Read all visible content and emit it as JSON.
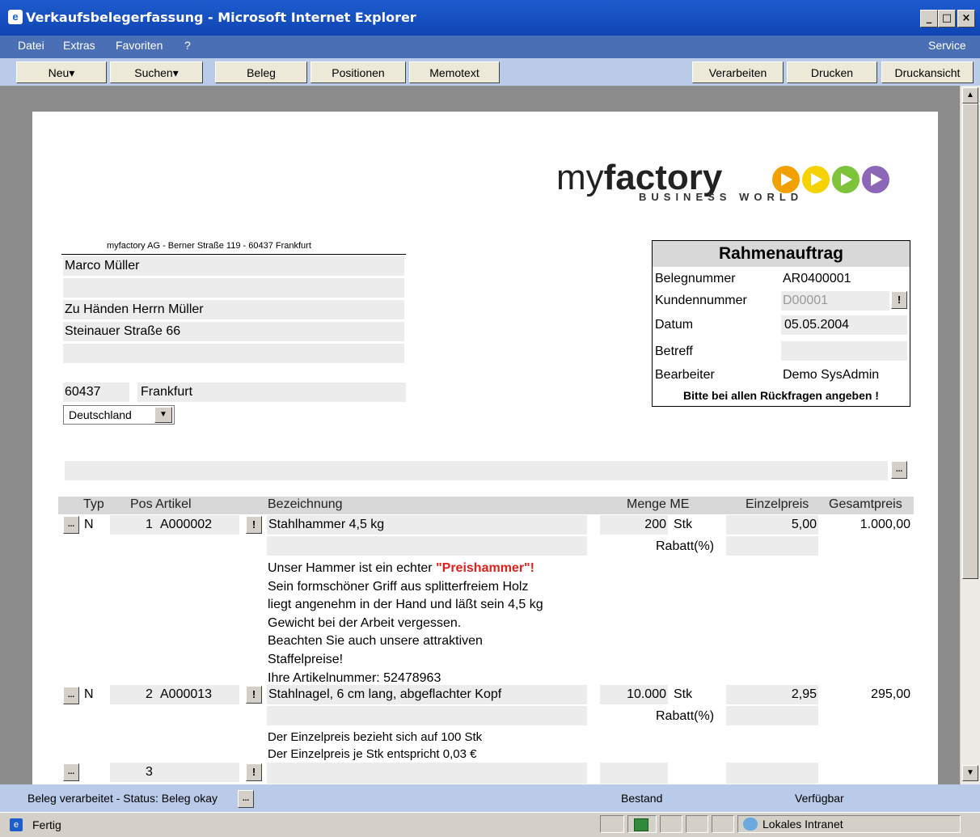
{
  "window": {
    "title": "Verkaufsbelegerfassung - Microsoft Internet Explorer",
    "btn_min": "_",
    "btn_max": "□",
    "btn_close": "×"
  },
  "menu": {
    "datei": "Datei",
    "extras": "Extras",
    "favoriten": "Favoriten",
    "help": "?",
    "service": "Service"
  },
  "toolbar": {
    "neu": "Neu▾",
    "suchen": "Suchen▾",
    "beleg": "Beleg",
    "positionen": "Positionen",
    "memotext": "Memotext",
    "verarbeiten": "Verarbeiten",
    "drucken": "Drucken",
    "druckansicht": "Druckansicht"
  },
  "logo": {
    "part1": "my",
    "part2": "factory",
    "tagline": "BUSINESS WORLD"
  },
  "address": {
    "sender": "myfactory AG - Berner Straße 119 - 60437 Frankfurt",
    "name": "Marco Müller",
    "line2": "",
    "attention": "Zu Händen Herrn Müller",
    "street": "Steinauer Straße 66",
    "line5": "",
    "zip": "60437",
    "city": "Frankfurt",
    "country": "Deutschland"
  },
  "docbox": {
    "title": "Rahmenauftrag",
    "belegnummer_label": "Belegnummer",
    "belegnummer": "AR0400001",
    "kundennummer_label": "Kundennummer",
    "kundennummer": "D00001",
    "datum_label": "Datum",
    "datum": "05.05.2004",
    "betreff_label": "Betreff",
    "betreff": "",
    "bearbeiter_label": "Bearbeiter",
    "bearbeiter": "Demo SysAdmin",
    "note": "Bitte bei allen Rückfragen angeben !"
  },
  "table": {
    "headers": {
      "typ": "Typ",
      "pos_artikel": "Pos Artikel",
      "bezeichnung": "Bezeichnung",
      "menge_me": "Menge ME",
      "einzelpreis": "Einzelpreis",
      "gesamtpreis": "Gesamtpreis"
    },
    "rows": [
      {
        "typ": "N",
        "pos": "1",
        "artikel": "A000002",
        "bezeichnung": "Stahlhammer 4,5 kg",
        "menge": "200",
        "me": "Stk",
        "einzelpreis": "5,00",
        "gesamtpreis": "1.000,00",
        "rabatt": "Rabatt(%)"
      },
      {
        "typ": "N",
        "pos": "2",
        "artikel": "A000013",
        "bezeichnung": "Stahlnagel, 6 cm lang, abgeflachter Kopf",
        "menge": "10.000",
        "me": "Stk",
        "einzelpreis": "2,95",
        "gesamtpreis": "295,00",
        "rabatt": "Rabatt(%)"
      },
      {
        "typ": "",
        "pos": "3",
        "artikel": "",
        "bezeichnung": ""
      }
    ],
    "memo1": {
      "l1a": "Unser Hammer ist ein echter ",
      "l1b": "\"Preishammer\"!",
      "l2": "Sein formschöner Griff aus splitterfreiem Holz",
      "l3": "liegt angenehm in der Hand und läßt sein 4,5 kg",
      "l4": "Gewicht bei der Arbeit vergessen.",
      "l5": "Beachten Sie auch unsere attraktiven",
      "l6": "Staffelpreise!",
      "l7": "Ihre Artikelnummer: 52478963"
    },
    "memo2": {
      "l1": "Der Einzelpreis bezieht sich auf 100 Stk",
      "l2": "Der Einzelpreis je Stk entspricht 0,03 €"
    }
  },
  "statusbar": {
    "status": "Beleg verarbeitet - Status: Beleg okay",
    "bestand": "Bestand",
    "verfuegbar": "Verfügbar"
  },
  "iestatus": {
    "fertig": "Fertig",
    "zone": "Lokales Intranet"
  },
  "colors": {
    "accent_red": "#e0201a",
    "logo_orange": "#f2a000",
    "logo_yellow": "#f5d200",
    "logo_green": "#7ec43a",
    "logo_purple": "#8c67b8"
  }
}
